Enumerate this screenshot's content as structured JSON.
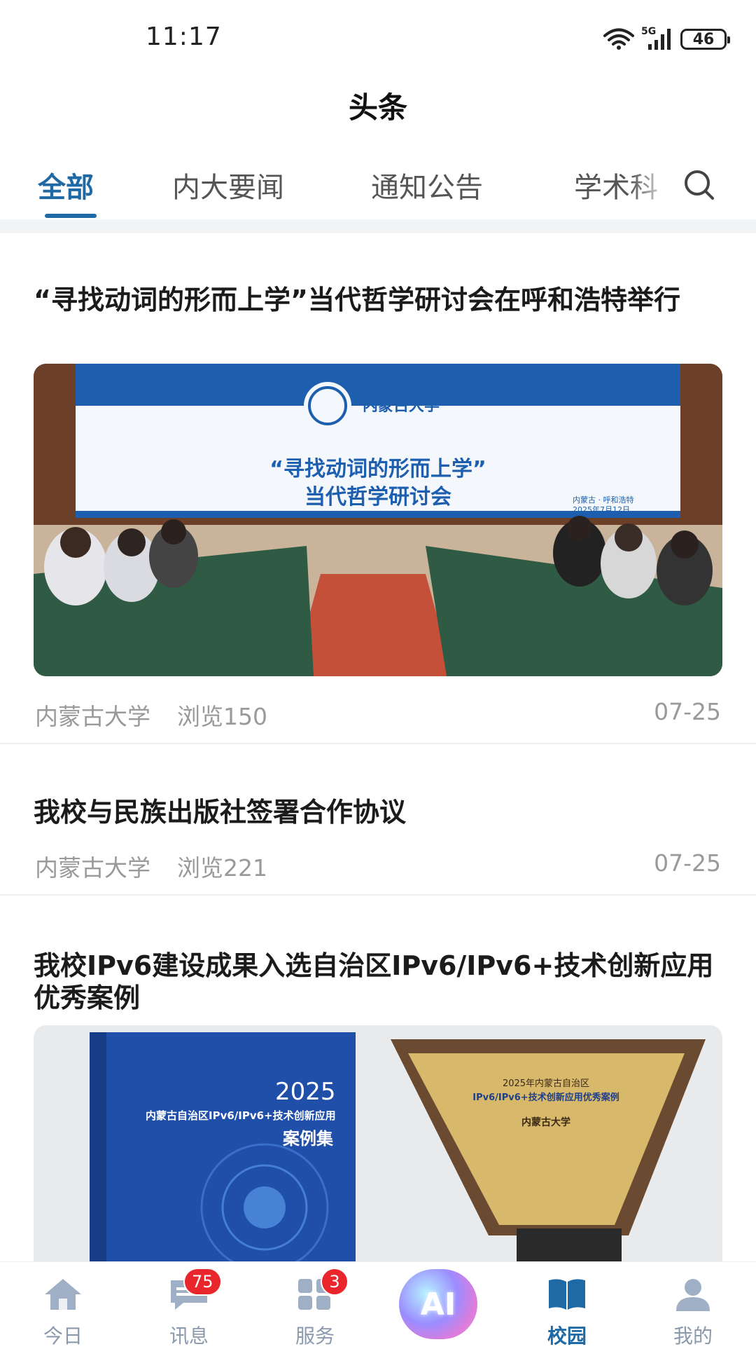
{
  "status_bar": {
    "time": "11:17",
    "network": "5G",
    "battery": "46"
  },
  "header": {
    "title": "头条"
  },
  "tabs": [
    {
      "label": "全部",
      "active": true
    },
    {
      "label": "内大要闻",
      "active": false
    },
    {
      "label": "通知公告",
      "active": false
    },
    {
      "label": "学术科",
      "active": false
    }
  ],
  "articles": [
    {
      "title": "“寻找动词的形而上学”当代哲学研讨会在呼和浩特举行",
      "source": "内蒙古大学",
      "views": "浏览150",
      "date": "07-25",
      "image": {
        "banner_line1": "“寻找动词的形而上学”",
        "banner_line2": "当代哲学研讨会",
        "banner_org": "内蒙古大学",
        "banner_place": "内蒙古 · 呼和浩特",
        "banner_date": "2025年7月12日"
      }
    },
    {
      "title": "我校与民族出版社签署合作协议",
      "source": "内蒙古大学",
      "views": "浏览221",
      "date": "07-25"
    },
    {
      "title": "我校IPv6建设成果入选自治区IPv6/IPv6+技术创新应用优秀案例",
      "image": {
        "book_year": "2025",
        "book_subtitle": "内蒙古自治区IPv6/IPv6+技术创新应用",
        "book_title": "案例集",
        "plaque_line1": "2025年内蒙古自治区",
        "plaque_line2": "IPv6/IPv6+技术创新应用优秀案例",
        "plaque_org": "内蒙古大学"
      }
    }
  ],
  "bottom_nav": [
    {
      "label": "今日",
      "icon": "home-icon",
      "badge": null,
      "active": false
    },
    {
      "label": "讯息",
      "icon": "message-icon",
      "badge": "75",
      "active": false
    },
    {
      "label": "服务",
      "icon": "grid-icon",
      "badge": "3",
      "active": false
    },
    {
      "label": "AI",
      "icon": "ai-icon",
      "badge": null,
      "active": false
    },
    {
      "label": "校园",
      "icon": "book-icon",
      "badge": null,
      "active": true
    },
    {
      "label": "我的",
      "icon": "person-icon",
      "badge": null,
      "active": false
    }
  ],
  "colors": {
    "accent": "#1f6aa5",
    "badge": "#e8262b",
    "muted": "#9a9a9a",
    "nav_inactive": "#8b99ad"
  }
}
